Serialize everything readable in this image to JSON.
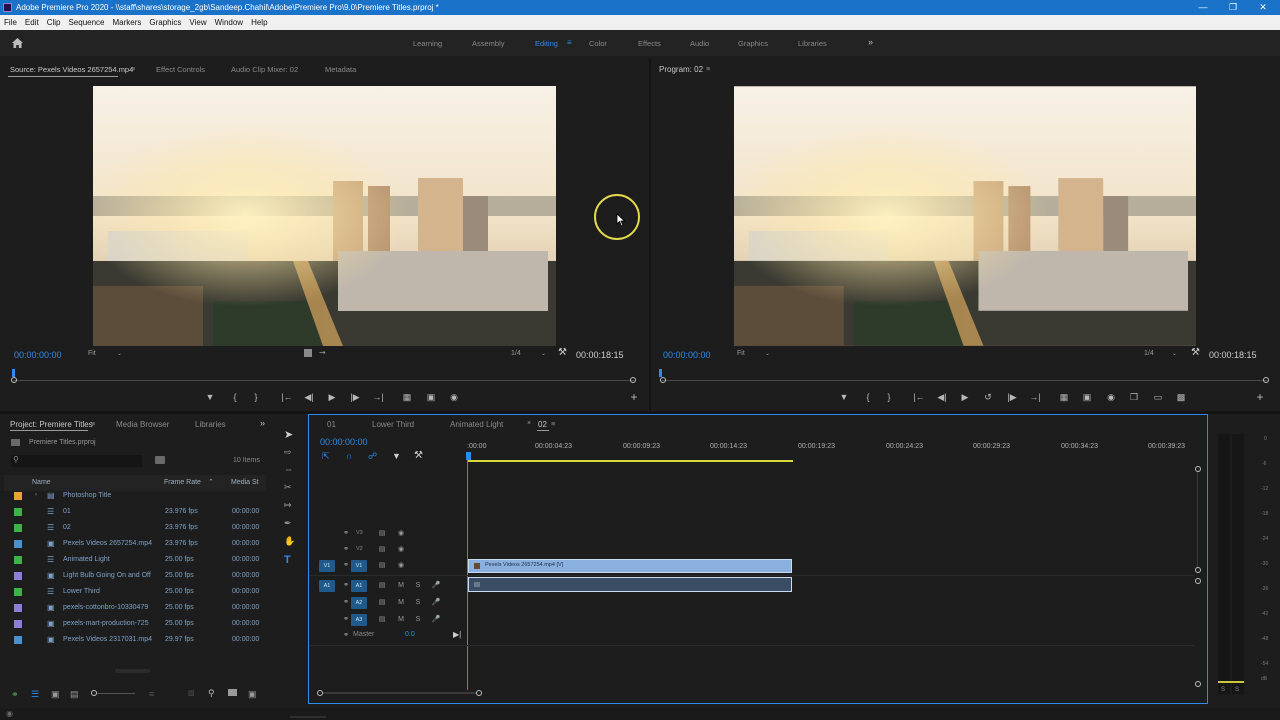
{
  "window": {
    "title": "Adobe Premiere Pro 2020 - \\\\staff\\shares\\storage_2gb\\Sandeep.Chahil\\Adobe\\Premiere Pro\\9.0\\Premiere Titles.prproj *"
  },
  "menu": [
    "File",
    "Edit",
    "Clip",
    "Sequence",
    "Markers",
    "Graphics",
    "View",
    "Window",
    "Help"
  ],
  "workspaces": [
    "Learning",
    "Assembly",
    "Editing",
    "Color",
    "Effects",
    "Audio",
    "Graphics",
    "Libraries"
  ],
  "workspaces_active": "Editing",
  "workspace_more": "»",
  "source_panel": {
    "tabs": [
      "Source: Pexels Videos 2657254.mp4",
      "Effect Controls",
      "Audio Clip Mixer: 02",
      "Metadata"
    ],
    "timecode": "00:00:00:00",
    "fit": "Fit",
    "resolution": "1/4",
    "duration": "00:00:18:15"
  },
  "program_panel": {
    "tab": "Program: 02",
    "timecode": "00:00:00:00",
    "fit": "Fit",
    "resolution": "1/4",
    "duration": "00:00:18:15"
  },
  "project_panel": {
    "tabs": [
      "Project: Premiere Titles",
      "Media Browser",
      "Libraries"
    ],
    "project_file": "Premiere Titles.prproj",
    "items_count": "10 Items",
    "columns": {
      "name": "Name",
      "frame_rate": "Frame Rate",
      "media_start": "Media St"
    },
    "rows": [
      {
        "name": "Photoshop Title",
        "frame_rate": "",
        "media_start": "",
        "color": "#e8a33a",
        "type": "folder"
      },
      {
        "name": "01",
        "frame_rate": "23.976 fps",
        "media_start": "00:00:00",
        "color": "#3fb24a",
        "type": "sequence"
      },
      {
        "name": "02",
        "frame_rate": "23.976 fps",
        "media_start": "00:00:00",
        "color": "#3fb24a",
        "type": "sequence"
      },
      {
        "name": "Pexels Videos 2657254.mp4",
        "frame_rate": "23.976 fps",
        "media_start": "00:00:00",
        "color": "#4a8fd0",
        "type": "clip"
      },
      {
        "name": "Animated Light",
        "frame_rate": "25.00 fps",
        "media_start": "00:00:00",
        "color": "#3fb24a",
        "type": "sequence"
      },
      {
        "name": "Light Bulb Going On and Off",
        "frame_rate": "25.00 fps",
        "media_start": "00:00:00",
        "color": "#8b7fd6",
        "type": "clip"
      },
      {
        "name": "Lower Third",
        "frame_rate": "25.00 fps",
        "media_start": "00:00:00",
        "color": "#3fb24a",
        "type": "sequence"
      },
      {
        "name": "pexels-cottonbro-10330479",
        "frame_rate": "25.00 fps",
        "media_start": "00:00:00",
        "color": "#8b7fd6",
        "type": "clip"
      },
      {
        "name": "pexels-mart-production-725",
        "frame_rate": "25.00 fps",
        "media_start": "00:00:00",
        "color": "#8b7fd6",
        "type": "clip"
      },
      {
        "name": "Pexels Videos 2317031.mp4",
        "frame_rate": "29.97 fps",
        "media_start": "00:00:00",
        "color": "#4a8fd0",
        "type": "clip"
      }
    ]
  },
  "timeline": {
    "tabs": [
      "01",
      "Lower Third",
      "Animated Light",
      "02"
    ],
    "active_tab": "02",
    "timecode": "00:00:00:00",
    "ruler": [
      ":00:00",
      "00:00:04:23",
      "00:00:09:23",
      "00:00:14:23",
      "00:00:19:23",
      "00:00:24:23",
      "00:00:29:23",
      "00:00:34:23",
      "00:00:39:23"
    ],
    "video_tracks": [
      "V3",
      "V2",
      "V1"
    ],
    "audio_tracks": [
      "A1",
      "A2",
      "A3"
    ],
    "source_v": "V1",
    "source_a": "A1",
    "mute": "M",
    "solo": "S",
    "master_label": "Master",
    "master_value": "0.0",
    "clip_video_label": "Pexels Videos 2657254.mp4 [V]"
  },
  "audio_meter": {
    "labels": [
      "0",
      "-6",
      "-12",
      "-18",
      "-24",
      "-30",
      "-36",
      "-42",
      "-48",
      "-54",
      "dB"
    ],
    "solo": "S"
  }
}
